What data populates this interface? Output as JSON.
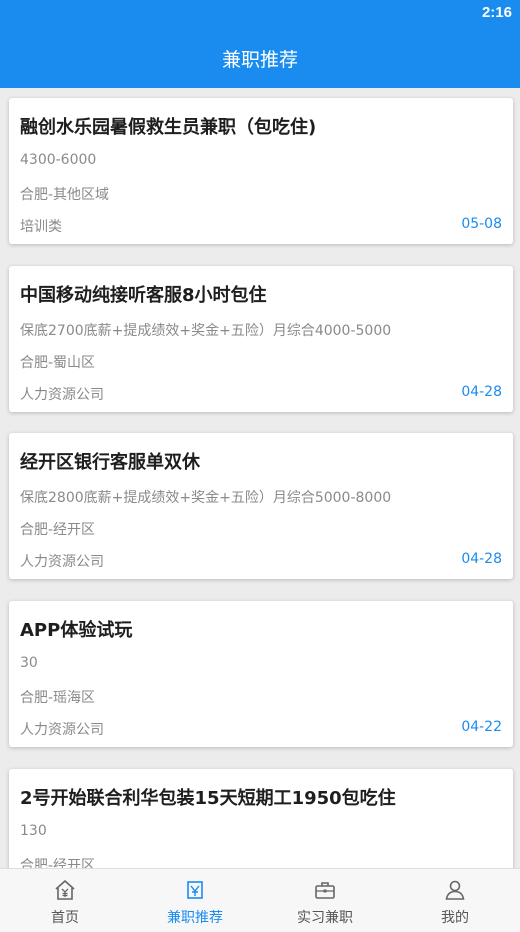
{
  "status_bar": {
    "time": "2:16"
  },
  "header": {
    "title": "兼职推荐"
  },
  "jobs": [
    {
      "title": "融创水乐园暑假救生员兼职（包吃住)",
      "salary": "4300-6000",
      "location": "合肥-其他区域",
      "category": "培训类",
      "date": "05-08"
    },
    {
      "title": "中国移动纯接听客服8小时包住",
      "salary": "保底2700底薪+提成绩效+奖金+五险）月综合4000-5000",
      "location": "合肥-蜀山区",
      "category": "人力资源公司",
      "date": "04-28"
    },
    {
      "title": "经开区银行客服单双休",
      "salary": "保底2800底薪+提成绩效+奖金+五险）月综合5000-8000",
      "location": "合肥-经开区",
      "category": "人力资源公司",
      "date": "04-28"
    },
    {
      "title": "APP体验试玩",
      "salary": "30",
      "location": "合肥-瑶海区",
      "category": "人力资源公司",
      "date": "04-22"
    },
    {
      "title": "2号开始联合利华包装15天短期工1950包吃住",
      "salary": "130",
      "location": "合肥-经开区",
      "category": "",
      "date": ""
    }
  ],
  "tabs": [
    {
      "label": "首页",
      "icon": "home-yen-icon",
      "active": false
    },
    {
      "label": "兼职推荐",
      "icon": "recommend-icon",
      "active": true
    },
    {
      "label": "实习兼职",
      "icon": "briefcase-icon",
      "active": false
    },
    {
      "label": "我的",
      "icon": "user-icon",
      "active": false
    }
  ],
  "colors": {
    "primary": "#1a8cf0",
    "background": "#ececec",
    "card": "#ffffff",
    "title_text": "#1e1e1e",
    "secondary_text": "#8a8a8a"
  }
}
